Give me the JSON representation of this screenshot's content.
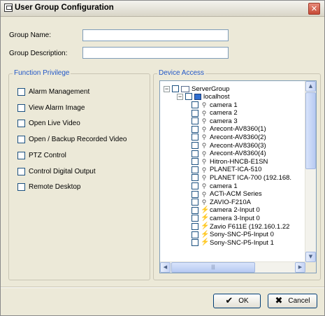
{
  "window": {
    "title": "User Group Configuration",
    "close_glyph": "✕"
  },
  "form": {
    "group_name_label": "Group Name:",
    "group_name_value": "",
    "group_description_label": "Group Description:",
    "group_description_value": ""
  },
  "function_privilege": {
    "legend": "Function Privilege",
    "items": [
      {
        "label": "Alarm Management",
        "checked": false
      },
      {
        "label": "View Alarm Image",
        "checked": false
      },
      {
        "label": "Open Live Video",
        "checked": false
      },
      {
        "label": "Open / Backup Recorded Video",
        "checked": false
      },
      {
        "label": "PTZ Control",
        "checked": false
      },
      {
        "label": "Control Digital Output",
        "checked": false
      },
      {
        "label": "Remote Desktop",
        "checked": false
      }
    ]
  },
  "device_access": {
    "legend": "Device Access",
    "server_group": "ServerGroup",
    "host": "localhost",
    "devices": [
      {
        "label": "camera 1",
        "icon": "camera-icon"
      },
      {
        "label": "camera 2",
        "icon": "camera-icon"
      },
      {
        "label": "camera 3",
        "icon": "camera-icon"
      },
      {
        "label": "Arecont-AV8360(1)",
        "icon": "camera-icon"
      },
      {
        "label": "Arecont-AV8360(2)",
        "icon": "camera-icon"
      },
      {
        "label": "Arecont-AV8360(3)",
        "icon": "camera-icon"
      },
      {
        "label": "Arecont-AV8360(4)",
        "icon": "camera-icon"
      },
      {
        "label": "Hitron-HNCB-E1SN",
        "icon": "camera-icon"
      },
      {
        "label": "PLANET-ICA-510",
        "icon": "camera-icon"
      },
      {
        "label": "PLANET ICA-700 (192.168.",
        "icon": "camera-icon"
      },
      {
        "label": "camera 1",
        "icon": "camera-icon"
      },
      {
        "label": "ACTi-ACM Series",
        "icon": "camera-icon"
      },
      {
        "label": "ZAVIO-F210A",
        "icon": "camera-icon"
      },
      {
        "label": "camera 2-Input 0",
        "icon": "io-icon"
      },
      {
        "label": "camera 3-Input 0",
        "icon": "io-icon"
      },
      {
        "label": "Zavio F611E (192.160.1.22",
        "icon": "io-icon"
      },
      {
        "label": "Sony-SNC-P5-Input 0",
        "icon": "io-icon"
      },
      {
        "label": "Sony-SNC-P5-Input 1",
        "icon": "io-icon"
      }
    ],
    "scroll_arrows": {
      "up": "▲",
      "down": "▼",
      "left": "◀",
      "right": "▶",
      "grip": "|||"
    }
  },
  "buttons": {
    "ok_label": "OK",
    "ok_glyph": "✔",
    "cancel_label": "Cancel",
    "cancel_glyph": "✖"
  }
}
